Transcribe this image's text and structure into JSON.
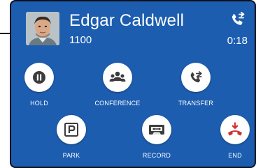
{
  "caller": {
    "name": "Edgar Caldwell",
    "extension": "1100",
    "avatar_icon": "caller-photo"
  },
  "call": {
    "duration": "0:18",
    "status_icon": "transfer-call-icon"
  },
  "actions": {
    "hold": {
      "label": "HOLD",
      "icon": "pause-icon"
    },
    "conference": {
      "label": "CONFERENCE",
      "icon": "people-icon"
    },
    "transfer": {
      "label": "TRANSFER",
      "icon": "call-transfer-icon"
    },
    "park": {
      "label": "PARK",
      "icon": "parking-icon"
    },
    "record": {
      "label": "RECORD",
      "icon": "cassette-icon"
    },
    "end": {
      "label": "END",
      "icon": "hangup-icon",
      "color": "#d32f2f"
    }
  },
  "colors": {
    "background": "#1c5db0",
    "button": "#ffffff",
    "icon": "#3c3c3c",
    "end": "#d32f2f"
  }
}
